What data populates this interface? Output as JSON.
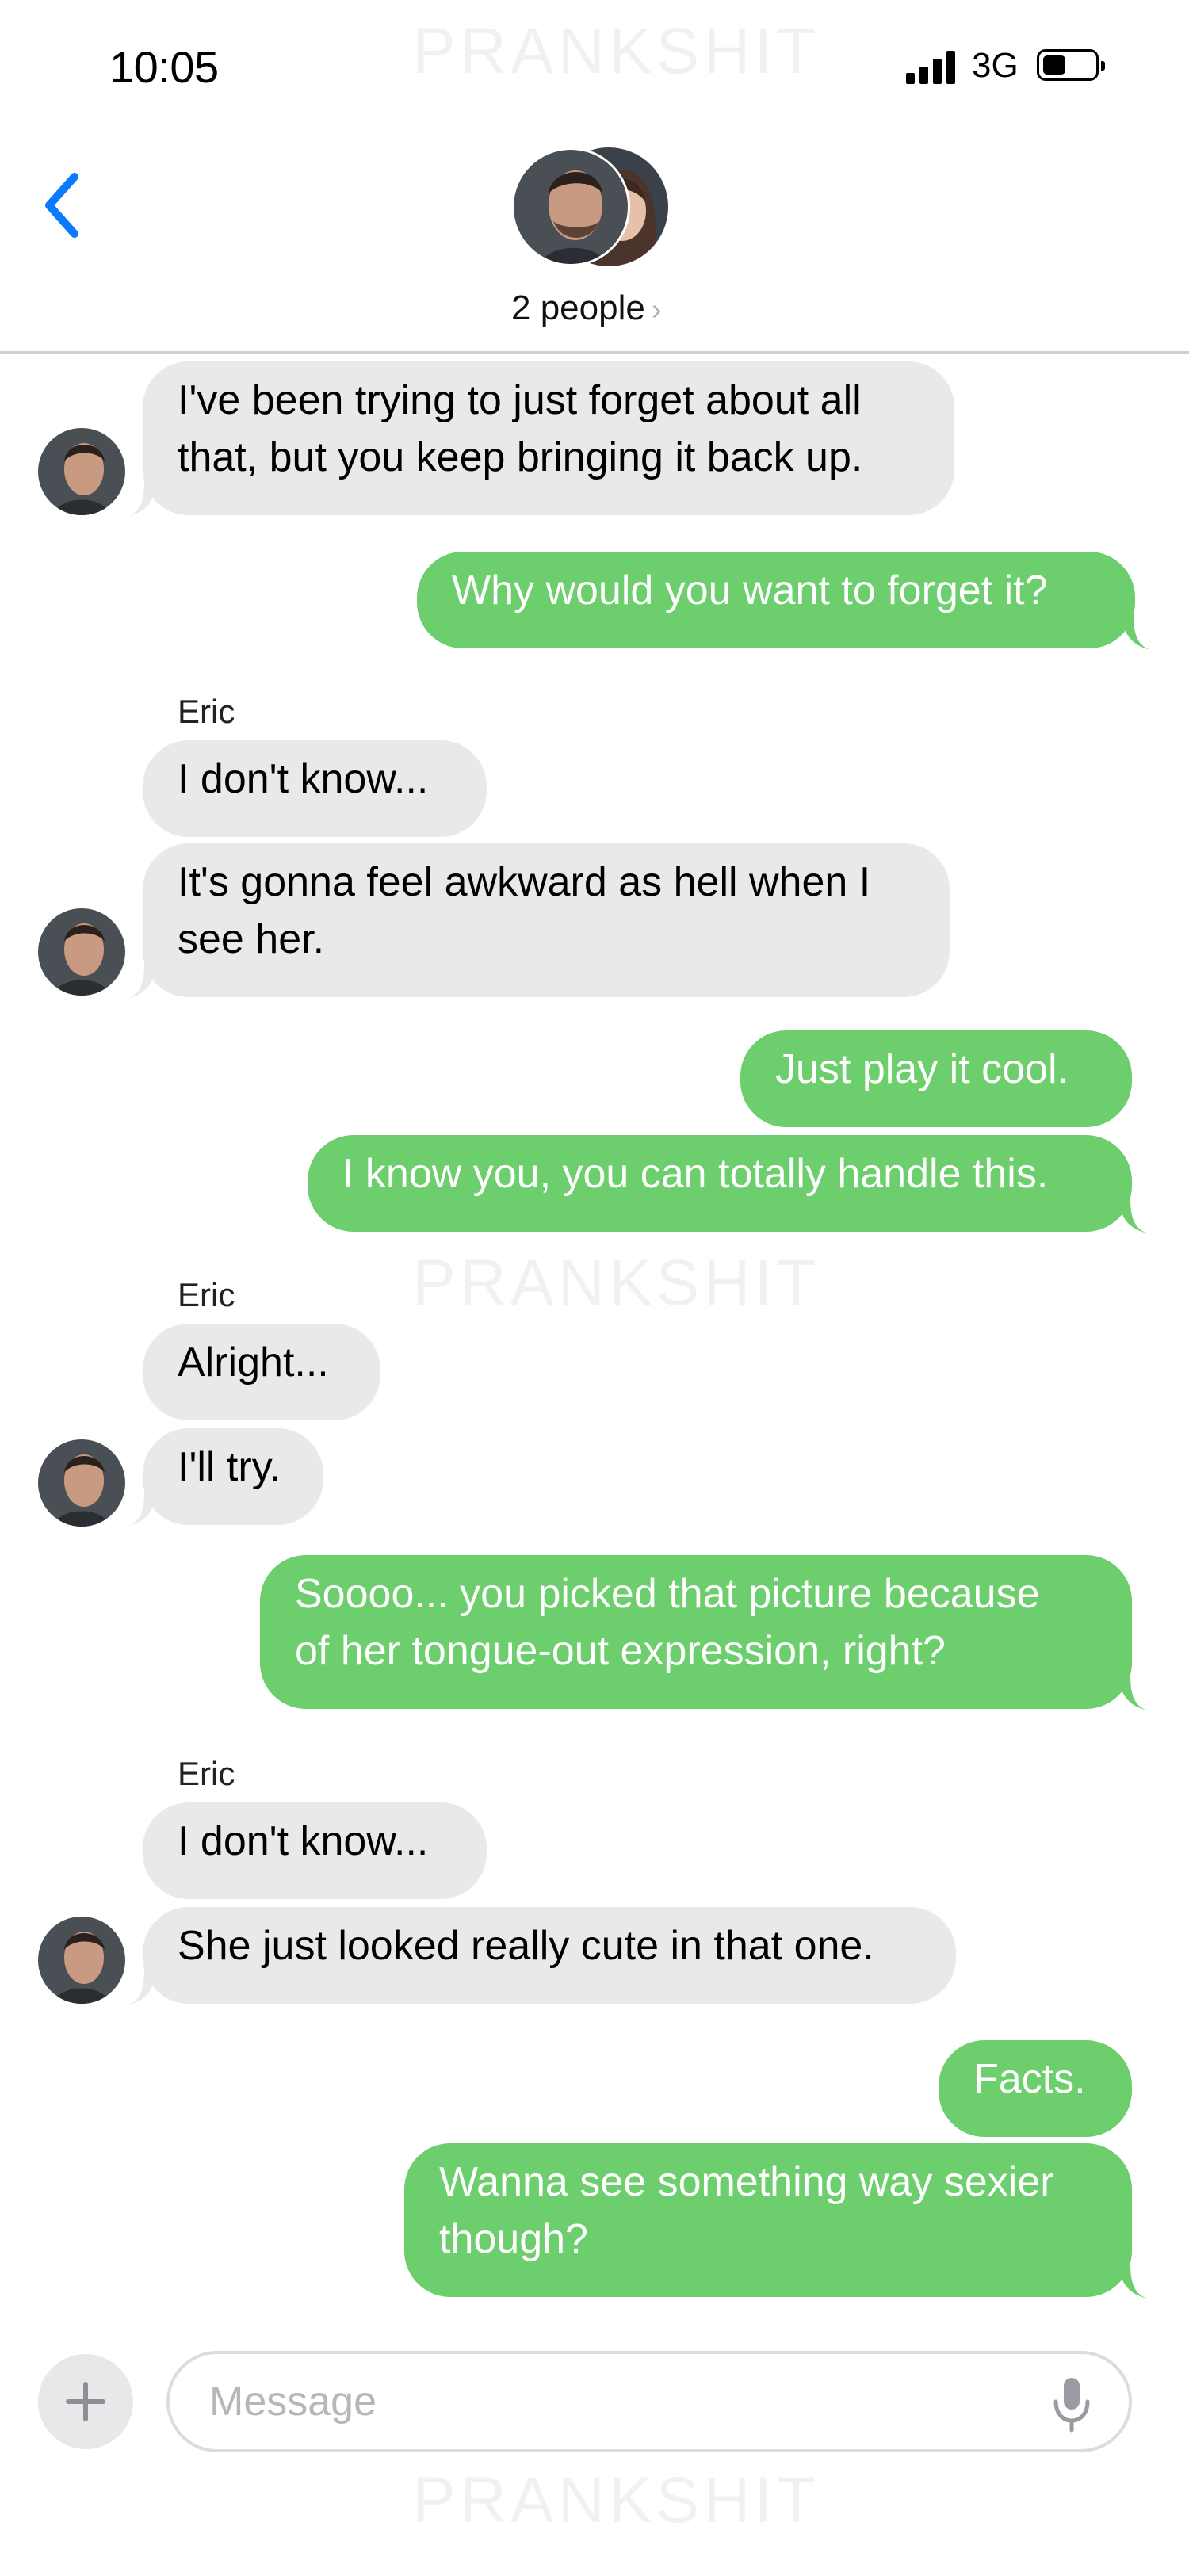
{
  "status_bar": {
    "time": "10:05",
    "network": "3G"
  },
  "header": {
    "people_label": "2 people"
  },
  "watermark": "PRANKSHIT",
  "messages": [
    {
      "text": [
        "I've been trying to just forget about all",
        "that, but you keep bringing it back up."
      ]
    },
    {
      "text": [
        "Why would you want to forget it?"
      ]
    },
    {
      "sender": "Eric"
    },
    {
      "text": [
        "I don't know..."
      ]
    },
    {
      "text": [
        "It's gonna feel awkward as hell when I",
        "see her."
      ]
    },
    {
      "text": [
        "Just play it cool."
      ]
    },
    {
      "text": [
        "I know you, you can totally handle this."
      ]
    },
    {
      "sender": "Eric"
    },
    {
      "text": [
        "Alright..."
      ]
    },
    {
      "text": [
        "I'll try."
      ]
    },
    {
      "text": [
        "Soooo... you picked that picture because",
        "of her tongue-out expression, right?"
      ]
    },
    {
      "sender": "Eric"
    },
    {
      "text": [
        "I don't know..."
      ]
    },
    {
      "text": [
        "She just looked really cute in that one."
      ]
    },
    {
      "text": [
        "Facts."
      ]
    },
    {
      "text": [
        "Wanna see something way sexier",
        "though?"
      ]
    }
  ],
  "composer": {
    "placeholder": "Message"
  },
  "colors": {
    "incoming_bubble": "#e9e9eb",
    "outgoing_bubble": "#6cce6c",
    "accent_blue": "#0a7aff"
  }
}
